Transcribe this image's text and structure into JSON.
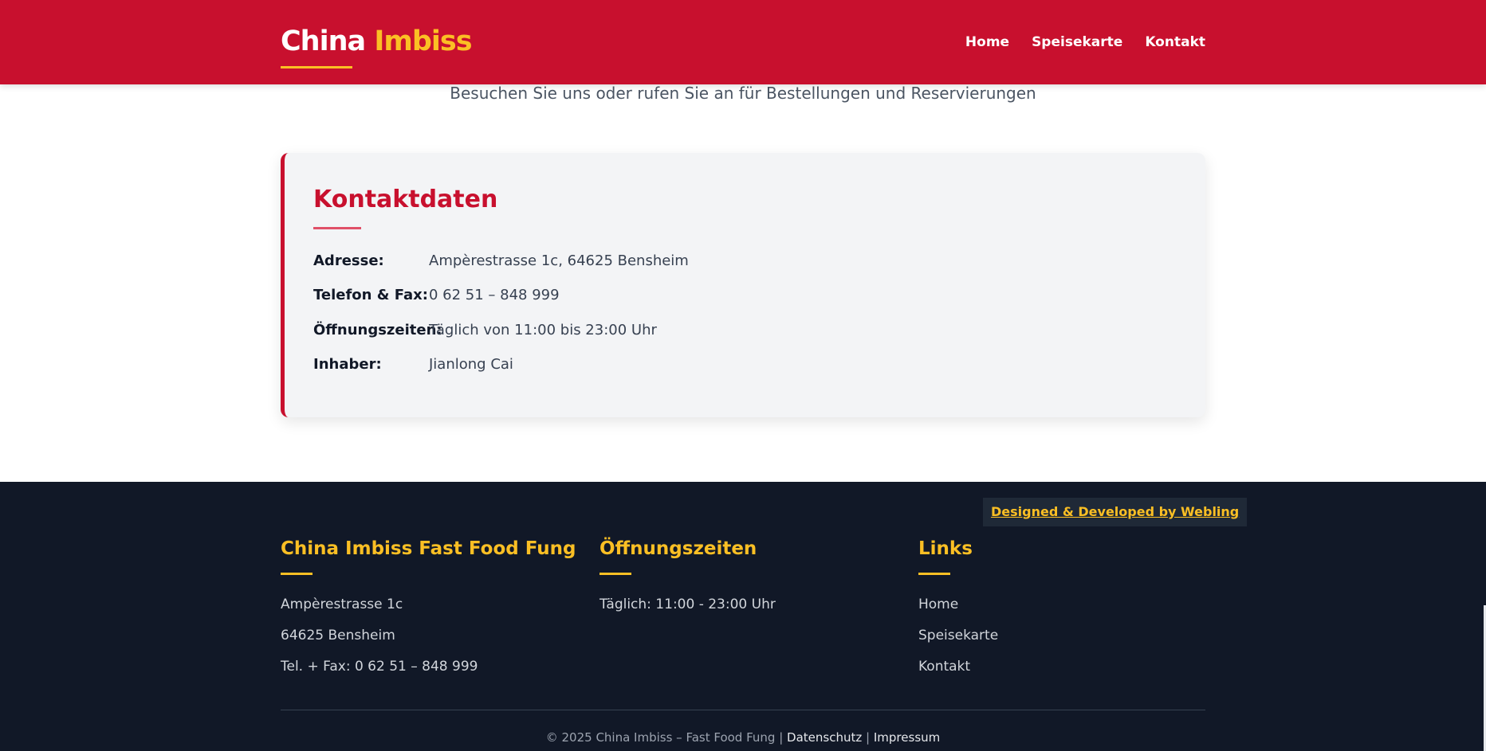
{
  "header": {
    "logo_part1": "China",
    "logo_part2": "Imbiss",
    "nav": [
      "Home",
      "Speisekarte",
      "Kontakt"
    ]
  },
  "intro": "Besuchen Sie uns oder rufen Sie an für Bestellungen und Reservierungen",
  "contact": {
    "title": "Kontaktdaten",
    "rows": [
      {
        "label": "Adresse:",
        "value": "Ampèrestrasse 1c, 64625 Bensheim"
      },
      {
        "label": "Telefon & Fax:",
        "value": "0 62 51 – 848 999"
      },
      {
        "label": "Öffnungszeiten:",
        "value": "Täglich von 11:00 bis 23:00 Uhr"
      },
      {
        "label": "Inhaber:",
        "value": "Jianlong Cai"
      }
    ]
  },
  "footer": {
    "credit": "Designed & Developed by Webling",
    "col1": {
      "title": "China Imbiss Fast Food Fung",
      "lines": [
        "Ampèrestrasse 1c",
        "64625 Bensheim",
        "Tel. + Fax: 0 62 51 – 848 999"
      ]
    },
    "col2": {
      "title": "Öffnungszeiten",
      "lines": [
        "Täglich: 11:00 - 23:00 Uhr"
      ]
    },
    "col3": {
      "title": "Links",
      "links": [
        "Home",
        "Speisekarte",
        "Kontakt"
      ]
    },
    "copyright": "© 2025 China Imbiss – Fast Food Fung |",
    "datenschutz": "Datenschutz",
    "separator": "|",
    "impressum": "Impressum"
  },
  "colors": {
    "brand_red": "#c8102e",
    "accent_yellow": "#fbbf24",
    "footer_bg": "#111827"
  }
}
